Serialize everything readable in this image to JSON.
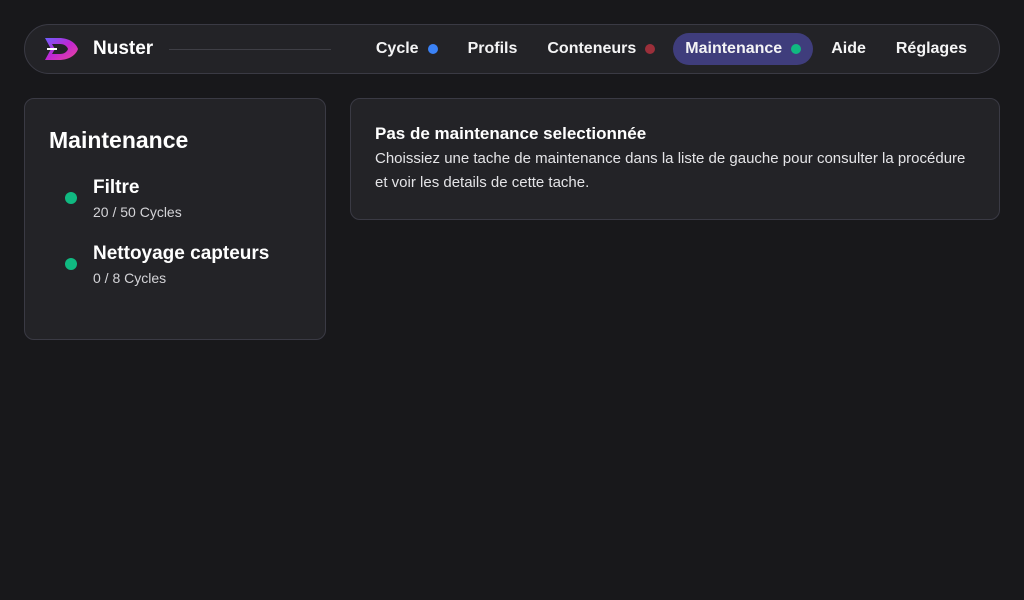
{
  "app": {
    "name": "Nuster",
    "logo_icon": "nuster-logo-icon"
  },
  "nav": {
    "items": [
      {
        "label": "Cycle",
        "status_color": "#3b82f6",
        "active": false
      },
      {
        "label": "Profils",
        "active": false
      },
      {
        "label": "Conteneurs",
        "status_color": "#9b2f3a",
        "active": false
      },
      {
        "label": "Maintenance",
        "status_color": "#10b981",
        "active": true
      },
      {
        "label": "Aide",
        "active": false
      },
      {
        "label": "Réglages",
        "active": false
      }
    ]
  },
  "sidebar": {
    "title": "Maintenance",
    "tasks": [
      {
        "name": "Filtre",
        "cycles": "20 / 50 Cycles",
        "status_color": "#10b981"
      },
      {
        "name": "Nettoyage capteurs",
        "cycles": "0 / 8 Cycles",
        "status_color": "#10b981"
      }
    ]
  },
  "detail": {
    "title": "Pas de maintenance selectionnée",
    "body": "Choissiez une tache de maintenance dans la liste de gauche pour consulter la procédure et voir les details de cette tache."
  }
}
